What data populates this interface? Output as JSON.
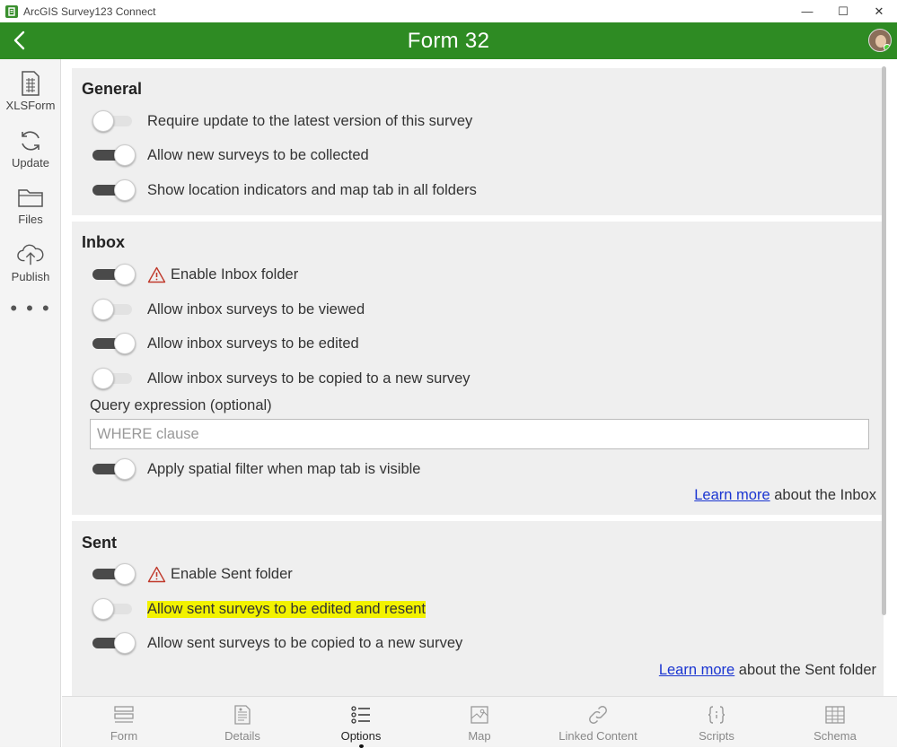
{
  "window": {
    "app_title": "ArcGIS Survey123 Connect",
    "minimize": "—",
    "maximize": "☐",
    "close": "✕"
  },
  "header": {
    "title": "Form 32",
    "back_icon": "chevron-left-icon",
    "accent_color": "#2e8b23"
  },
  "sidebar": {
    "items": [
      {
        "label": "XLSForm",
        "icon": "spreadsheet-icon"
      },
      {
        "label": "Update",
        "icon": "refresh-icon"
      },
      {
        "label": "Files",
        "icon": "folder-icon"
      },
      {
        "label": "Publish",
        "icon": "cloud-upload-icon"
      }
    ],
    "more": "• • •"
  },
  "general": {
    "heading": "General",
    "options": [
      {
        "label": "Require update to the latest version of this survey",
        "on": false
      },
      {
        "label": "Allow new surveys to be collected",
        "on": true
      },
      {
        "label": "Show location indicators and map tab in all folders",
        "on": true
      }
    ]
  },
  "inbox": {
    "heading": "Inbox",
    "options": [
      {
        "label": "Enable Inbox folder",
        "on": true,
        "warning": true
      },
      {
        "label": "Allow inbox surveys to be viewed",
        "on": false
      },
      {
        "label": "Allow inbox surveys to be edited",
        "on": true
      },
      {
        "label": "Allow inbox surveys to be copied to a new survey",
        "on": false
      }
    ],
    "query_label": "Query expression (optional)",
    "query_placeholder": "WHERE clause",
    "query_value": "",
    "spatial_filter": {
      "label": "Apply spatial filter when map tab is visible",
      "on": true
    },
    "learn_more_link": "Learn more",
    "learn_more_suffix": " about the Inbox"
  },
  "sent": {
    "heading": "Sent",
    "options": [
      {
        "label": "Enable Sent folder",
        "on": true,
        "warning": true
      },
      {
        "label": "Allow sent surveys to be edited and resent",
        "on": false,
        "highlighted": true
      },
      {
        "label": "Allow sent surveys to be copied to a new survey",
        "on": true
      }
    ],
    "learn_more_link": "Learn more",
    "learn_more_suffix": " about the Sent folder"
  },
  "tabs": [
    {
      "label": "Form",
      "icon": "form-icon",
      "active": false
    },
    {
      "label": "Details",
      "icon": "details-icon",
      "active": false
    },
    {
      "label": "Options",
      "icon": "options-list-icon",
      "active": true
    },
    {
      "label": "Map",
      "icon": "map-icon",
      "active": false
    },
    {
      "label": "Linked Content",
      "icon": "link-icon",
      "active": false
    },
    {
      "label": "Scripts",
      "icon": "scripts-icon",
      "active": false
    },
    {
      "label": "Schema",
      "icon": "schema-table-icon",
      "active": false
    }
  ]
}
